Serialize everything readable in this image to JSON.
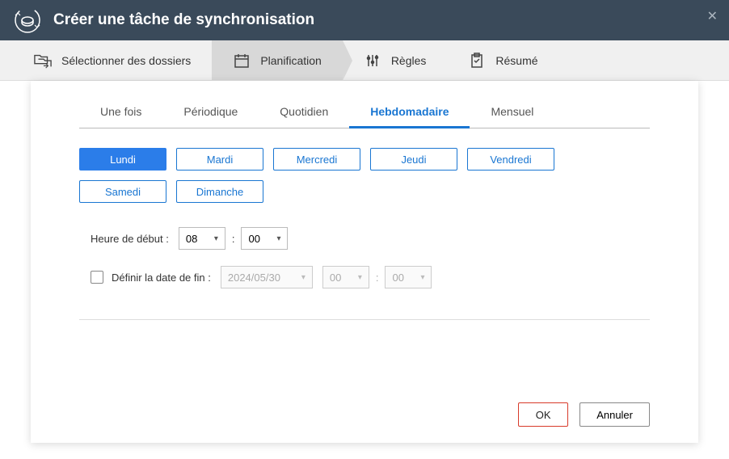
{
  "titlebar": {
    "title": "Créer une tâche de synchronisation"
  },
  "stepper": {
    "step1": "Sélectionner des dossiers",
    "step2": "Planification",
    "step3": "Règles",
    "step4": "Résumé"
  },
  "tabs": {
    "once": "Une fois",
    "periodic": "Périodique",
    "daily": "Quotidien",
    "weekly": "Hebdomadaire",
    "monthly": "Mensuel"
  },
  "days": {
    "mon": "Lundi",
    "tue": "Mardi",
    "wed": "Mercredi",
    "thu": "Jeudi",
    "fri": "Vendredi",
    "sat": "Samedi",
    "sun": "Dimanche"
  },
  "timing": {
    "start_label": "Heure de début :",
    "start_hour": "08",
    "start_min": "00",
    "end_label": "Définir la date de fin :",
    "end_date": "2024/05/30",
    "end_hour": "00",
    "end_min": "00"
  },
  "footer": {
    "ok": "OK",
    "cancel": "Annuler"
  }
}
